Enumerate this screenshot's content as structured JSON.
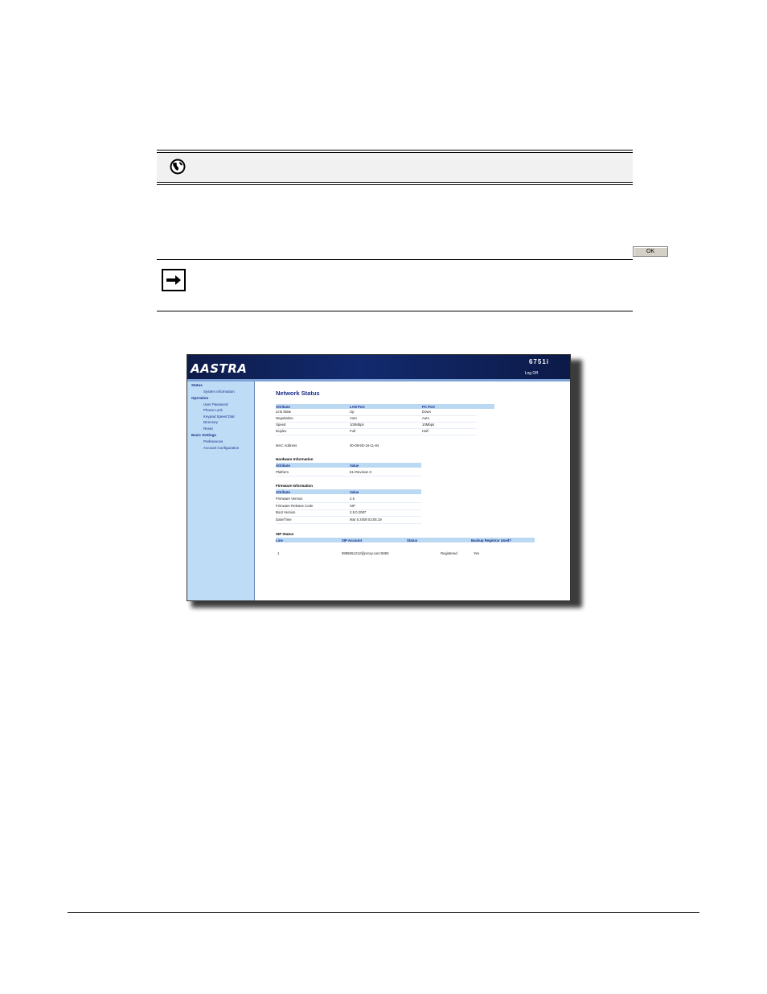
{
  "ok_button": {
    "label": "OK"
  },
  "screenshot": {
    "header": {
      "logo": "AASTRA",
      "model": "6751i",
      "logoff": "Log Off"
    },
    "sidebar": {
      "groups": [
        {
          "label": "Status",
          "items": [
            "System Information"
          ]
        },
        {
          "label": "Operation",
          "items": [
            "User Password",
            "Phone Lock",
            "Keypad Speed Dial",
            "Directory",
            "Reset"
          ]
        },
        {
          "label": "Basic Settings",
          "items": [
            "Preferences",
            "Account Configuration"
          ]
        }
      ]
    },
    "title": "Network Status",
    "network_table": {
      "headers": [
        "Attribute",
        "LAN Port",
        "PC Port"
      ],
      "rows": [
        [
          "Link State",
          "Up",
          "Down"
        ],
        [
          "Negotiation",
          "Auto",
          "Auto"
        ],
        [
          "Speed",
          "100Mbps",
          "10Mbps"
        ],
        [
          "Duplex",
          "Full",
          "Half"
        ]
      ],
      "mac_label": "MAC Address",
      "mac_value": "00-08-5D-16-11-84"
    },
    "hardware": {
      "title": "Hardware Information",
      "headers": [
        "Attribute",
        "Value"
      ],
      "rows": [
        [
          "Platform",
          "51i Revision 0"
        ]
      ]
    },
    "firmware": {
      "title": "Firmware Information",
      "headers": [
        "Attribute",
        "Value"
      ],
      "rows": [
        [
          "Firmware Version",
          "2.5"
        ],
        [
          "Firmware Release Code",
          "SIP"
        ],
        [
          "Boot Version",
          "2.5.0.2087"
        ],
        [
          "Date/Time",
          "Mar 5 2008 03:05:19"
        ]
      ]
    },
    "sip": {
      "title": "SIP Status",
      "headers": [
        "Line",
        "SIP Account",
        "Status",
        "Backup Registrar Used?"
      ],
      "rows": [
        [
          "1",
          "9995551212@proxy.com:5060",
          "Registered",
          "Yes"
        ]
      ]
    }
  },
  "icons": {
    "globe": "globe-icon",
    "arrow": "arrow-right-icon"
  }
}
